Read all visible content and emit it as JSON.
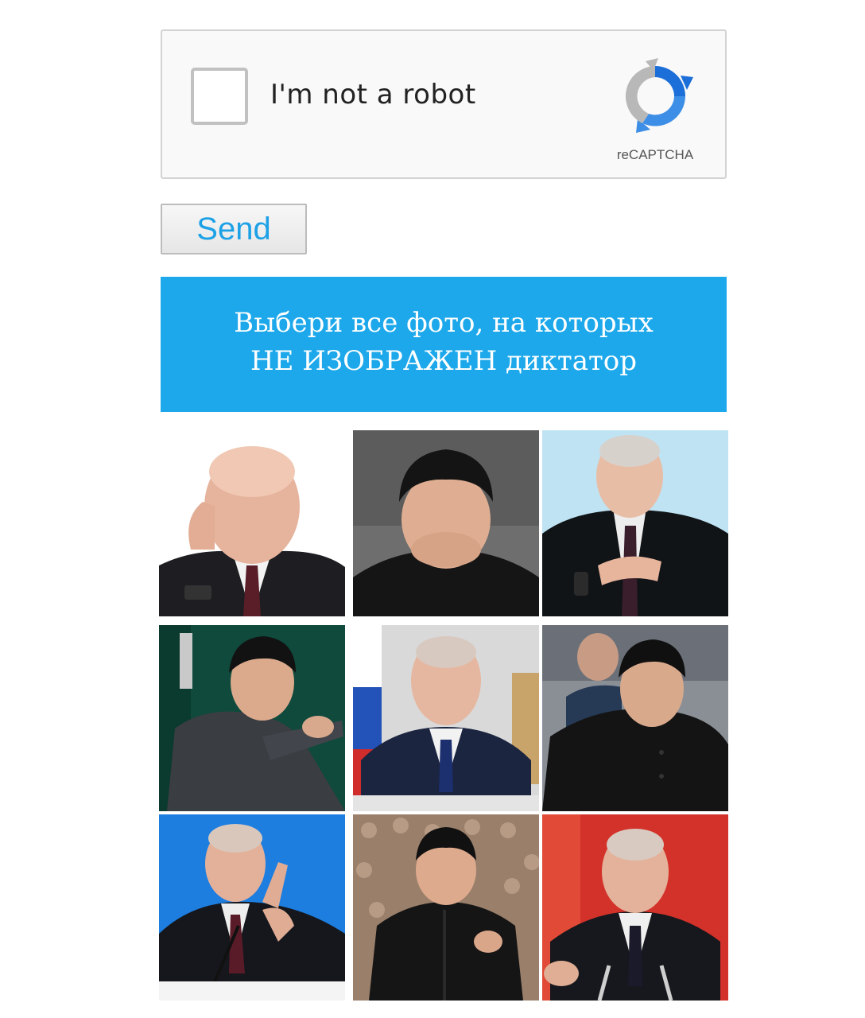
{
  "captcha": {
    "label": "I'm not a robot",
    "brand": "reCAPTCHA",
    "checked": false
  },
  "send_button": {
    "label": "Send"
  },
  "challenge": {
    "line1": "Выбери все фото, на которых",
    "line2": "НЕ ИЗОБРАЖЕН диктатор"
  },
  "colors": {
    "banner": "#1ca8ea",
    "send_text": "#1da1e6",
    "logo_blue": "#1c6fd8",
    "logo_grey": "#b8b8b8"
  },
  "grid": {
    "rows": 3,
    "columns": 3,
    "tiles": [
      {
        "subject": "man-bald-smiling-hand-on-cheek",
        "background": "#ffffff"
      },
      {
        "subject": "man-dark-hair-dark-tunic",
        "background": "#6e6e6e"
      },
      {
        "subject": "man-bald-gesturing-suit",
        "background": "#bfe3f2"
      },
      {
        "subject": "man-dark-hair-pointing-suit",
        "background": "#0f4a3c"
      },
      {
        "subject": "man-bald-seated-suit",
        "background": "#d9d9d9"
      },
      {
        "subject": "man-dark-hair-dark-coat",
        "background": "#8a8f96"
      },
      {
        "subject": "man-bald-pointing-microphone",
        "background": "#1d7ee0"
      },
      {
        "subject": "man-dark-hair-clapping-crowd",
        "background": "#9a7f6a"
      },
      {
        "subject": "man-bald-speaking-microphones",
        "background": "#d3322a"
      }
    ]
  }
}
